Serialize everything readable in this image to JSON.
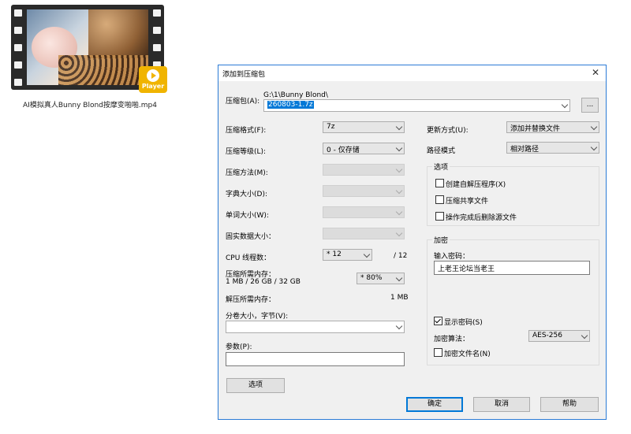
{
  "desktop_file": {
    "name": "AI模拟真人Bunny Blond按摩变啪啪.mp4",
    "badge": "Player"
  },
  "dialog": {
    "title": "添加到压缩包",
    "close": "✕",
    "archive": {
      "label": "压缩包(A):",
      "path": "G:\\1\\Bunny Blond\\",
      "filename": "260803-1.7z",
      "browse": "..."
    },
    "left": {
      "format": {
        "label": "压缩格式(F):",
        "value": "7z"
      },
      "level": {
        "label": "压缩等级(L):",
        "value": "0 - 仅存储"
      },
      "method": {
        "label": "压缩方法(M):",
        "value": ""
      },
      "dict": {
        "label": "字典大小(D):",
        "value": ""
      },
      "word": {
        "label": "单词大小(W):",
        "value": ""
      },
      "solid": {
        "label": "固实数据大小：",
        "value": ""
      },
      "cpu": {
        "label": "CPU 线程数：",
        "value": "* 12",
        "total": "/ 12"
      },
      "mem": {
        "label": "压缩所需内存：",
        "sub": "1 MB / 26 GB / 32 GB",
        "value": "* 80%"
      },
      "decomp": {
        "label": "解压所需内存：",
        "value": "1 MB"
      },
      "volume": {
        "label": "分卷大小，字节(V):",
        "value": ""
      },
      "params": {
        "label": "参数(P):",
        "value": ""
      },
      "options_button": "选项"
    },
    "right": {
      "update": {
        "label": "更新方式(U):",
        "value": "添加并替换文件"
      },
      "path": {
        "label": "路径模式",
        "value": "相对路径"
      },
      "options": {
        "title": "选项",
        "sfx": "创建自解压程序(X)",
        "shared": "压缩共享文件",
        "delete": "操作完成后删除源文件"
      },
      "encryption": {
        "title": "加密",
        "pw_label": "输入密码：",
        "password": "上老王论坛当老王",
        "show_pw": "显示密码(S)",
        "algo_label": "加密算法：",
        "algo": "AES-256",
        "encrypt_names": "加密文件名(N)"
      }
    },
    "buttons": {
      "ok": "确定",
      "cancel": "取消",
      "help": "帮助"
    }
  }
}
